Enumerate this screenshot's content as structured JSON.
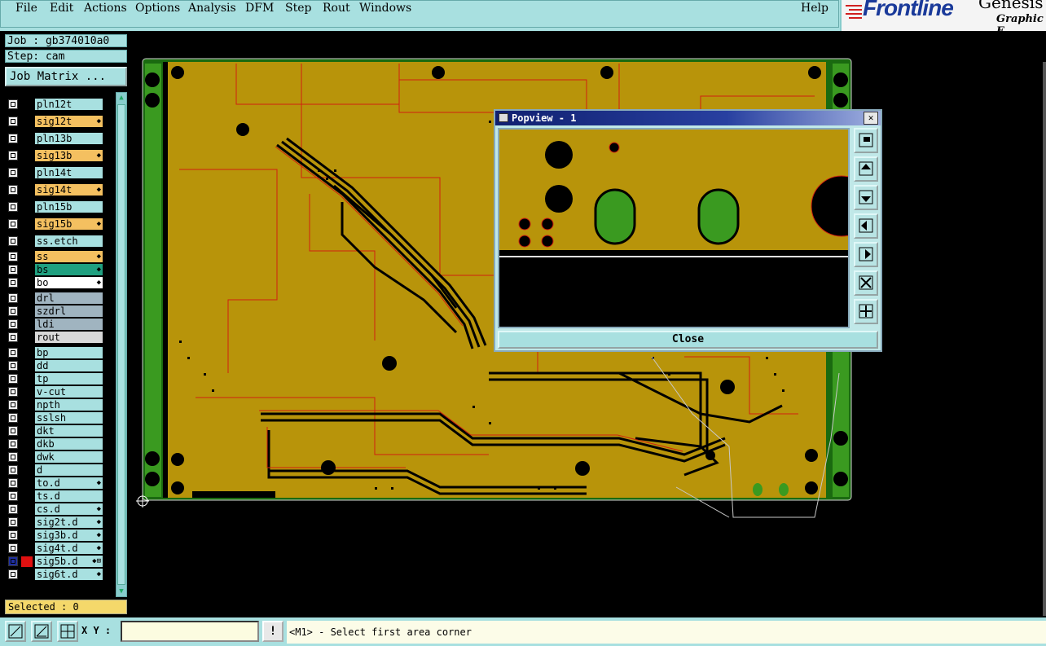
{
  "menu": [
    "File",
    "Edit",
    "Actions",
    "Options",
    "Analysis",
    "DFM",
    "Step",
    "Rout",
    "Windows"
  ],
  "help": "Help",
  "logo": {
    "word": "Frontline",
    "product": "Genesis",
    "sub": "Graphic E"
  },
  "job": {
    "job_label": "Job : gb374010a0",
    "step_label": "Step: cam",
    "matrix_button": "Job Matrix ..."
  },
  "layers": [
    {
      "name": "pln12t",
      "color": "#a8e0e0",
      "arrow": ""
    },
    {
      "name": "sig12t",
      "color": "#f4c060",
      "arrow": "◆"
    },
    {
      "name": "pln13b",
      "color": "#a8e0e0",
      "arrow": ""
    },
    {
      "name": "sig13b",
      "color": "#f4c060",
      "arrow": "◆"
    },
    {
      "name": "pln14t",
      "color": "#a8e0e0",
      "arrow": ""
    },
    {
      "name": "sig14t",
      "color": "#f4c060",
      "arrow": "◆"
    },
    {
      "name": "pln15b",
      "color": "#a8e0e0",
      "arrow": ""
    },
    {
      "name": "sig15b",
      "color": "#f4c060",
      "arrow": "◆"
    },
    {
      "name": "ss.etch",
      "color": "#a8e0e0",
      "arrow": ""
    },
    {
      "name": "ss",
      "color": "#f4c060",
      "arrow": "◆"
    },
    {
      "name": "bs",
      "color": "#20a080",
      "arrow": "◆"
    },
    {
      "name": "bo",
      "color": "#ffffff",
      "arrow": "◆"
    },
    {
      "name": "drl",
      "color": "#a0b4c0",
      "arrow": ""
    },
    {
      "name": "szdrl",
      "color": "#a0b4c0",
      "arrow": ""
    },
    {
      "name": "ldi",
      "color": "#a0b4c0",
      "arrow": ""
    },
    {
      "name": "rout",
      "color": "#d8d8d8",
      "arrow": ""
    },
    {
      "name": "bp",
      "color": "#a8e0e0",
      "arrow": ""
    },
    {
      "name": "dd",
      "color": "#a8e0e0",
      "arrow": ""
    },
    {
      "name": "tp",
      "color": "#a8e0e0",
      "arrow": ""
    },
    {
      "name": "v-cut",
      "color": "#a8e0e0",
      "arrow": ""
    },
    {
      "name": "npth",
      "color": "#a8e0e0",
      "arrow": ""
    },
    {
      "name": "sslsh",
      "color": "#a8e0e0",
      "arrow": ""
    },
    {
      "name": "dkt",
      "color": "#a8e0e0",
      "arrow": ""
    },
    {
      "name": "dkb",
      "color": "#a8e0e0",
      "arrow": ""
    },
    {
      "name": "dwk",
      "color": "#a8e0e0",
      "arrow": ""
    },
    {
      "name": "d",
      "color": "#a8e0e0",
      "arrow": ""
    },
    {
      "name": "to.d",
      "color": "#a8e0e0",
      "arrow": "◆"
    },
    {
      "name": "ts.d",
      "color": "#a8e0e0",
      "arrow": ""
    },
    {
      "name": "cs.d",
      "color": "#a8e0e0",
      "arrow": "◆"
    },
    {
      "name": "sig2t.d",
      "color": "#a8e0e0",
      "arrow": "◆"
    },
    {
      "name": "sig3b.d",
      "color": "#a8e0e0",
      "arrow": "◆"
    },
    {
      "name": "sig4t.d",
      "color": "#a8e0e0",
      "arrow": "◆"
    },
    {
      "name": "sig5b.d",
      "color": "#a8e0e0",
      "arrow": "◆⊞"
    },
    {
      "name": "sig6t.d",
      "color": "#a8e0e0",
      "arrow": "◆"
    }
  ],
  "selected": "Selected : 0",
  "status": {
    "xy_label": "X Y :",
    "xy_value": "",
    "excl": "!",
    "message": "<M1> - Select first area corner"
  },
  "popview": {
    "title": "Popview - 1",
    "close": "Close",
    "x_glyph": "✕"
  }
}
